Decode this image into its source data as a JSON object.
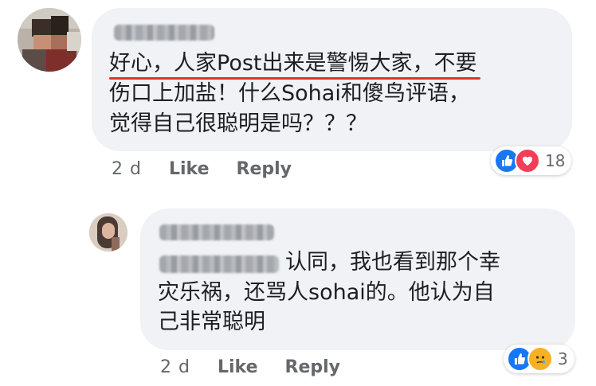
{
  "comments": [
    {
      "body_lines": [
        "好心，人家Post出来是警惕大家，不要",
        "伤口上加盐！什么Sohai和傻鸟评语，",
        "觉得自己很聪明是吗？？？"
      ],
      "time": "2 d",
      "like_label": "Like",
      "reply_label": "Reply",
      "reaction_count": "18",
      "reaction_icons": [
        "like-icon",
        "love-icon"
      ],
      "highlight_color": "#e0312e"
    },
    {
      "tag_line_rest": "认同，我也看到那个幸",
      "body_lines": [
        "灾乐祸，还骂人sohai的。他认为自",
        "己非常聪明"
      ],
      "time": "2 d",
      "like_label": "Like",
      "reply_label": "Reply",
      "reaction_count": "3",
      "reaction_icons": [
        "like-icon",
        "sad-icon"
      ]
    }
  ],
  "colors": {
    "bubble": "#f0f2f5",
    "like_blue": "#1877f2",
    "love_red": "#f33e58",
    "sad_yellow": "#f7b125",
    "meta_gray": "#65676b"
  }
}
